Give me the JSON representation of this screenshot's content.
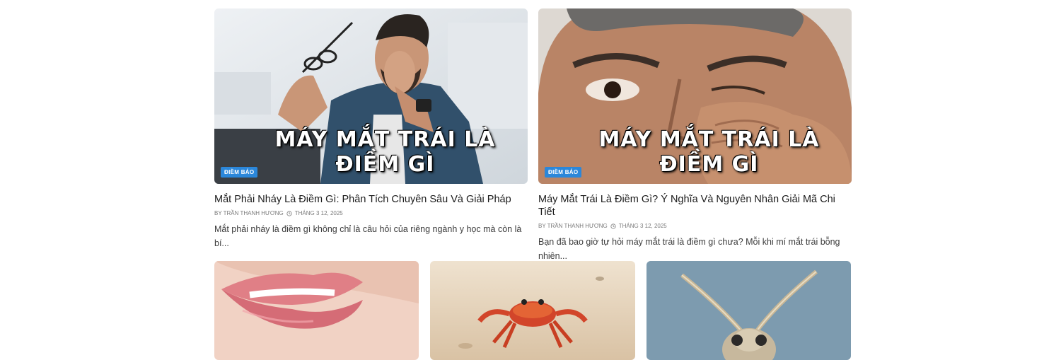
{
  "posts": [
    {
      "category": "ĐIỀM BÁO",
      "overlay": "MÁY MẮT TRÁI LÀ ĐIỀM GÌ",
      "title": "Mắt Phải Nháy Là Điềm Gì: Phân Tích Chuyên Sâu Và Giải Pháp",
      "author": "BY TRẦN THANH HƯƠNG",
      "date": "THÁNG 3 12, 2025",
      "excerpt": "Mắt phải nháy là điềm gì không chỉ là câu hỏi của riêng ngành y học mà còn là bí..."
    },
    {
      "category": "ĐIỀM BÁO",
      "overlay": "MÁY MẮT TRÁI LÀ ĐIỀM GÌ",
      "title": "Máy Mắt Trái Là Điềm Gì? Ý Nghĩa Và Nguyên Nhân Giải Mã Chi Tiết",
      "author": "BY TRẦN THANH HƯƠNG",
      "date": "THÁNG 3 12, 2025",
      "excerpt": "Bạn đã bao giờ tự hỏi máy mắt trái là điềm gì chưa? Mỗi khi mí mắt trái bỗng nhiên..."
    }
  ],
  "images": [
    {
      "icon": "man-rubbing-eyes-photo"
    },
    {
      "icon": "man-eye-closeup-photo"
    },
    {
      "icon": "lips-photo"
    },
    {
      "icon": "crab-photo"
    },
    {
      "icon": "moth-photo"
    }
  ]
}
